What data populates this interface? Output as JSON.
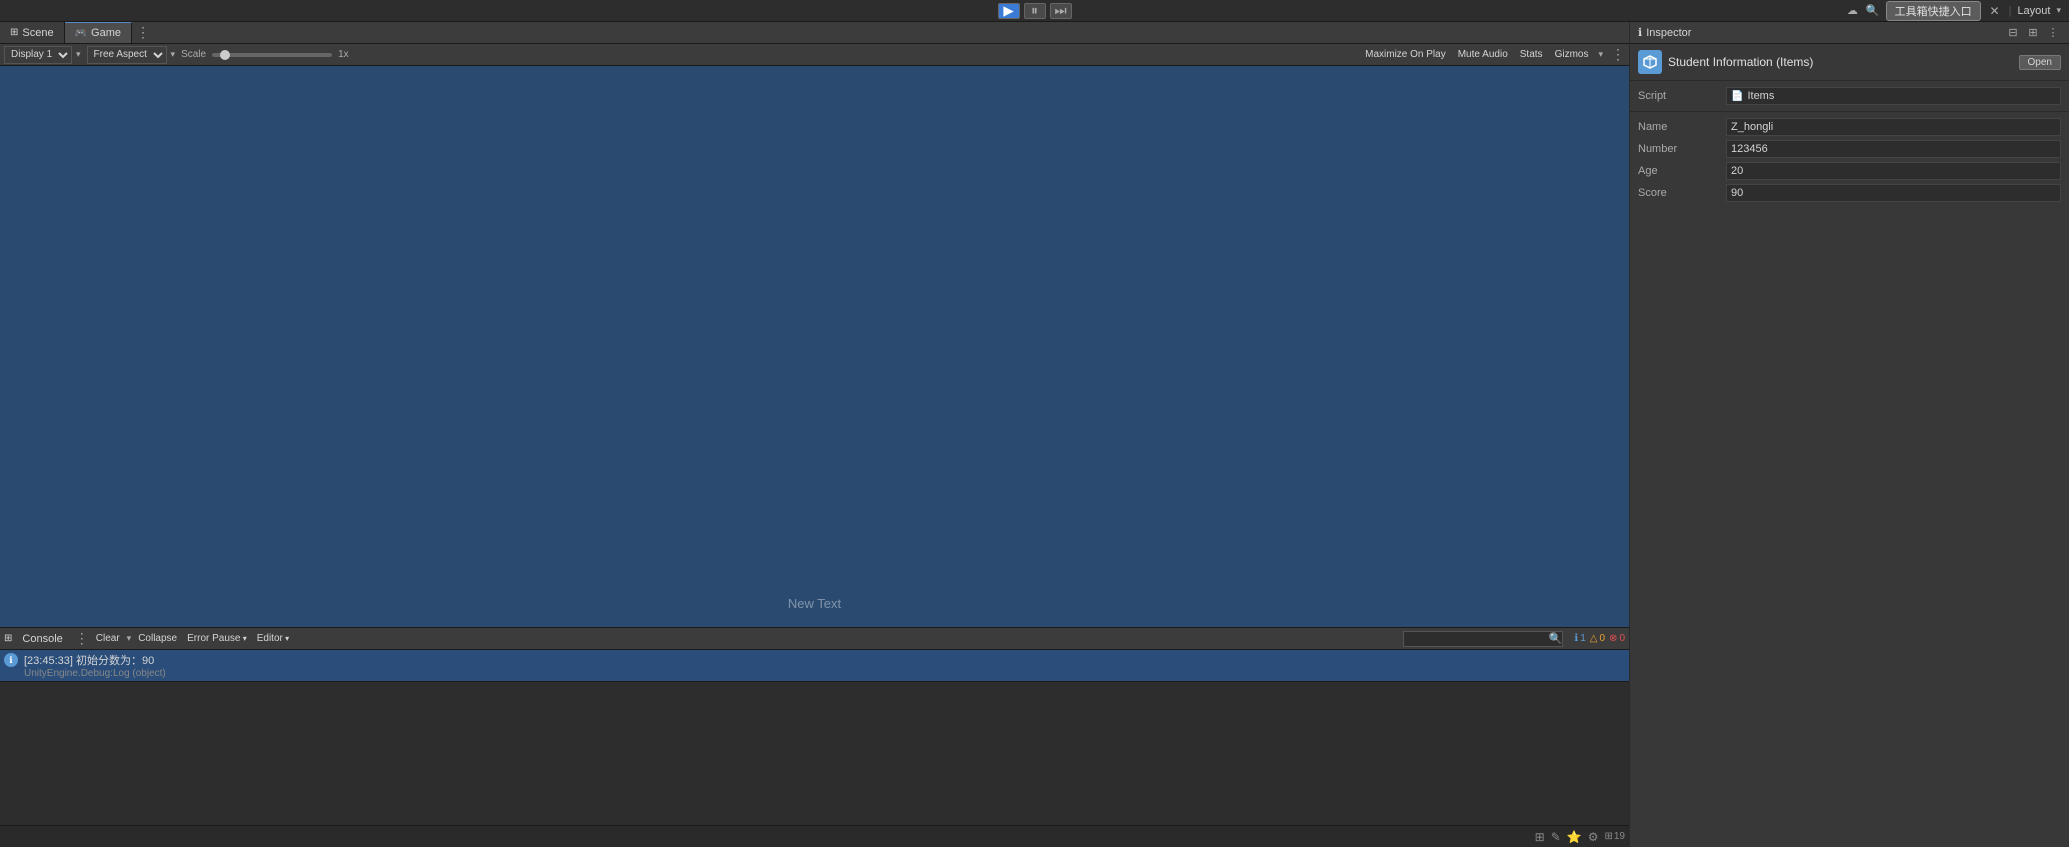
{
  "topbar": {
    "play_label": "▶",
    "pause_label": "⏸",
    "step_label": "⏭",
    "tool_input_label": "工具箱快捷入口",
    "close_label": "✕",
    "layout_label": "Layout"
  },
  "tabs": {
    "scene_label": "Scene",
    "game_label": "Game",
    "scene_icon": "⊞",
    "game_icon": "🎮"
  },
  "game_toolbar": {
    "display_label": "Display 1",
    "aspect_label": "Free Aspect",
    "scale_label": "Scale",
    "scale_value": "1x",
    "maximize_label": "Maximize On Play",
    "mute_label": "Mute Audio",
    "stats_label": "Stats",
    "gizmos_label": "Gizmos"
  },
  "game_view": {
    "new_text_label": "New Text"
  },
  "inspector": {
    "title": "Inspector",
    "component_name": "Student Information (Items)",
    "open_btn": "Open",
    "script_section": {
      "label": "Script",
      "value": "Items"
    },
    "fields": [
      {
        "label": "Name",
        "value": "Z_hongli"
      },
      {
        "label": "Number",
        "value": "123456"
      },
      {
        "label": "Age",
        "value": "20"
      },
      {
        "label": "Score",
        "value": "90"
      }
    ]
  },
  "console": {
    "tab_label": "Console",
    "tab_icon": "⊞",
    "clear_btn": "Clear",
    "collapse_btn": "Collapse",
    "error_pause_btn": "Error Pause",
    "editor_btn": "Editor",
    "search_placeholder": "",
    "counts": {
      "info": "1",
      "warning": "0",
      "error": "0"
    },
    "entries": [
      {
        "timestamp": "[23:45:33]",
        "message": "初始分数为：90",
        "sub": "UnityEngine.Debug:Log (object)",
        "selected": true
      }
    ]
  },
  "status_bar": {
    "icons": [
      "⊞",
      "✎",
      "⭐",
      "⚙"
    ],
    "count": "19"
  }
}
